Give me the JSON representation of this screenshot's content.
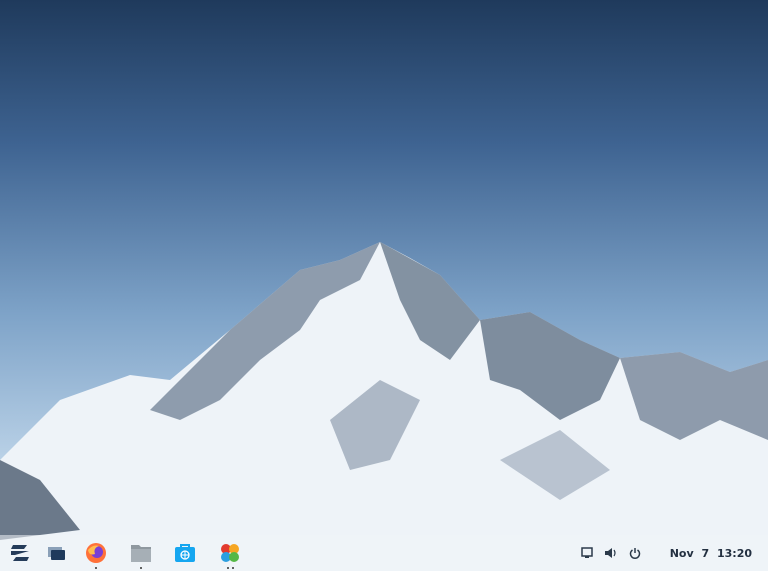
{
  "taskbar": {
    "apps": [
      {
        "name": "zorin-menu",
        "running": false
      },
      {
        "name": "workspaces",
        "running": false
      },
      {
        "name": "firefox",
        "running": true
      },
      {
        "name": "files",
        "running": true
      },
      {
        "name": "software",
        "running": false
      },
      {
        "name": "app-grid",
        "running": true
      }
    ],
    "tray": {
      "icons": [
        "display-icon",
        "volume-icon",
        "power-icon"
      ]
    },
    "clock": {
      "date": "Nov 7",
      "time": "13:20"
    }
  },
  "colors": {
    "accent": "#15a6f0"
  }
}
